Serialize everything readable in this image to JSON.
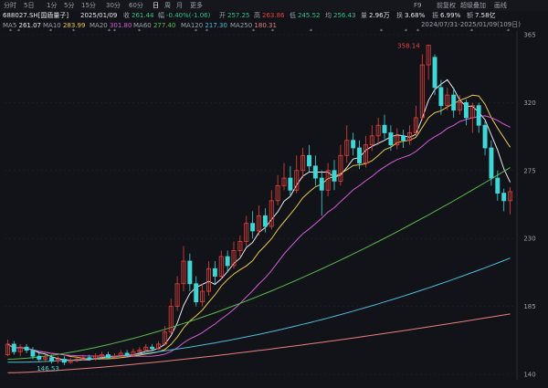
{
  "tabs": [
    "分时",
    "5日",
    "1分",
    "5分",
    "15分",
    "30分",
    "60分",
    "日",
    "周",
    "月",
    "更多"
  ],
  "active_tab": "日",
  "right_tabs": [
    "F9",
    "前复权",
    "超级叠加",
    "画线"
  ],
  "quote": {
    "symbol": "688027.SH[国盾量子]",
    "date": "2025/01/09",
    "close_label": "收",
    "close": "261.44",
    "change_label": "幅",
    "change": "-0.40%(-1.06)",
    "open_label": "开",
    "open": "257.25",
    "high_label": "高",
    "high": "263.86",
    "low_label": "低",
    "low": "245.52",
    "avg_label": "均",
    "avg": "256.43",
    "volume_label": "量",
    "volume": "2.96万",
    "turnover_label": "换",
    "turnover": "3.68%",
    "amplitude_label": "振",
    "amplitude": "6.99%",
    "amount_label": "额",
    "amount": "7.58亿"
  },
  "ma": [
    {
      "name": "MA5",
      "value": "261.07",
      "color": "#e6e9ee"
    },
    {
      "name": "MA10",
      "value": "283.99",
      "color": "#e8c84a"
    },
    {
      "name": "MA20",
      "value": "301.80",
      "color": "#d45ad8"
    },
    {
      "name": "MA60",
      "value": "277.40",
      "color": "#5ab84e"
    },
    {
      "name": "MA120",
      "value": "217.30",
      "color": "#4bbcd8"
    },
    {
      "name": "MA250",
      "value": "180.31",
      "color": "#e88080"
    }
  ],
  "date_range": "2024/07/31-2025/01/09(109日)",
  "chart_data": {
    "type": "candlestick",
    "y_ticks": [
      365,
      320,
      275,
      230,
      185,
      140
    ],
    "ylim": [
      140,
      365
    ],
    "max_label": "358.14",
    "min_label": "146.53",
    "colors": {
      "up": "#e8413c",
      "down": "#3fd6d6",
      "MA5": "#e6e9ee",
      "MA10": "#e8c84a",
      "MA20": "#d45ad8",
      "MA60": "#5ab84e",
      "MA120": "#4bbcd8",
      "MA250": "#e88080"
    },
    "candles": [
      [
        153,
        160,
        163,
        152
      ],
      [
        160,
        155,
        162,
        153
      ],
      [
        155,
        158,
        160,
        152
      ],
      [
        158,
        156,
        160,
        154
      ],
      [
        156,
        152,
        158,
        150
      ],
      [
        152,
        150,
        154,
        148
      ],
      [
        150,
        151,
        153,
        148
      ],
      [
        151,
        149,
        153,
        147
      ],
      [
        149,
        150,
        152,
        147
      ],
      [
        150,
        148,
        152,
        146
      ],
      [
        148,
        149,
        151,
        147
      ],
      [
        149,
        150,
        152,
        148
      ],
      [
        150,
        151,
        153,
        149
      ],
      [
        151,
        150,
        153,
        149
      ],
      [
        150,
        152,
        154,
        149
      ],
      [
        152,
        153,
        155,
        151
      ],
      [
        153,
        151,
        155,
        150
      ],
      [
        151,
        152,
        154,
        150
      ],
      [
        152,
        154,
        156,
        151
      ],
      [
        154,
        153,
        156,
        152
      ],
      [
        153,
        155,
        157,
        152
      ],
      [
        155,
        156,
        158,
        154
      ],
      [
        156,
        158,
        160,
        155
      ],
      [
        158,
        157,
        160,
        156
      ],
      [
        157,
        160,
        162,
        156
      ],
      [
        160,
        168,
        172,
        159
      ],
      [
        168,
        185,
        190,
        166
      ],
      [
        185,
        200,
        205,
        182
      ],
      [
        200,
        215,
        225,
        195
      ],
      [
        215,
        200,
        220,
        195
      ],
      [
        200,
        188,
        205,
        185
      ],
      [
        188,
        195,
        200,
        185
      ],
      [
        195,
        210,
        215,
        192
      ],
      [
        210,
        205,
        215,
        200
      ],
      [
        205,
        218,
        222,
        203
      ],
      [
        218,
        212,
        222,
        208
      ],
      [
        212,
        222,
        228,
        210
      ],
      [
        222,
        228,
        232,
        218
      ],
      [
        228,
        240,
        245,
        225
      ],
      [
        240,
        235,
        248,
        230
      ],
      [
        235,
        245,
        252,
        232
      ],
      [
        245,
        238,
        250,
        234
      ],
      [
        238,
        255,
        262,
        236
      ],
      [
        255,
        265,
        272,
        252
      ],
      [
        265,
        270,
        280,
        262
      ],
      [
        270,
        262,
        278,
        258
      ],
      [
        262,
        275,
        285,
        260
      ],
      [
        275,
        285,
        290,
        270
      ],
      [
        285,
        278,
        292,
        274
      ],
      [
        278,
        270,
        285,
        265
      ],
      [
        270,
        262,
        275,
        245
      ],
      [
        262,
        275,
        280,
        258
      ],
      [
        275,
        268,
        282,
        262
      ],
      [
        268,
        285,
        292,
        265
      ],
      [
        285,
        295,
        305,
        280
      ],
      [
        295,
        290,
        300,
        285
      ],
      [
        290,
        280,
        295,
        276
      ],
      [
        280,
        292,
        298,
        277
      ],
      [
        292,
        298,
        305,
        288
      ],
      [
        298,
        305,
        310,
        292
      ],
      [
        305,
        300,
        312,
        296
      ],
      [
        300,
        292,
        305,
        288
      ],
      [
        292,
        298,
        303,
        289
      ],
      [
        298,
        295,
        302,
        290
      ],
      [
        295,
        300,
        305,
        292
      ],
      [
        300,
        310,
        318,
        298
      ],
      [
        310,
        345,
        352,
        308
      ],
      [
        345,
        358,
        358,
        335
      ],
      [
        350,
        330,
        352,
        325
      ],
      [
        330,
        318,
        335,
        312
      ],
      [
        318,
        325,
        330,
        315
      ],
      [
        325,
        315,
        330,
        310
      ],
      [
        315,
        320,
        325,
        312
      ],
      [
        320,
        310,
        322,
        305
      ],
      [
        310,
        318,
        320,
        300
      ],
      [
        318,
        305,
        320,
        300
      ],
      [
        305,
        290,
        308,
        285
      ],
      [
        290,
        270,
        295,
        265
      ],
      [
        270,
        260,
        275,
        255
      ],
      [
        260,
        255,
        263,
        248
      ],
      [
        255,
        261,
        264,
        246
      ]
    ]
  }
}
